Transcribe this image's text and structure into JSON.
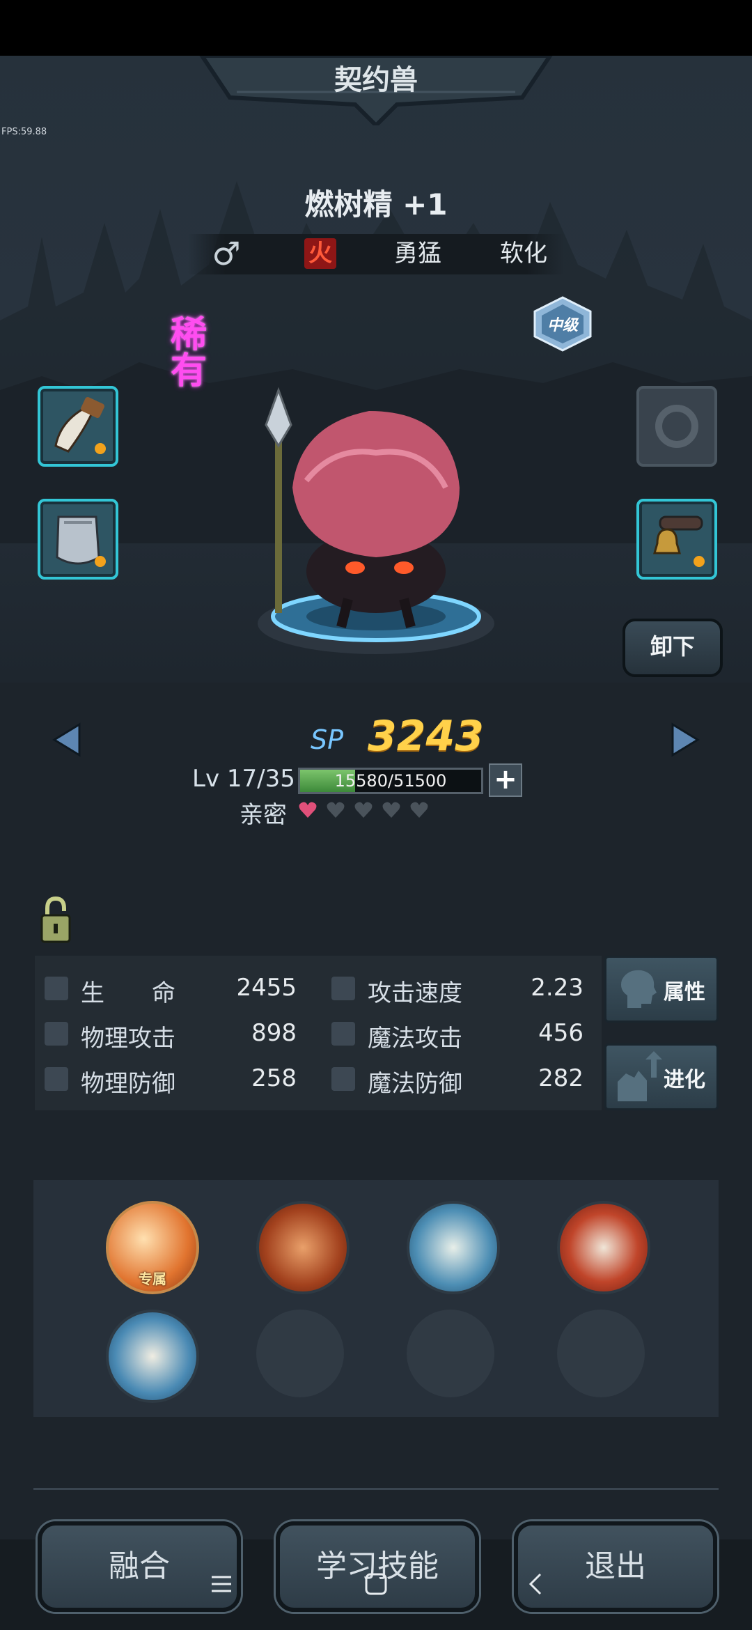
{
  "header": {
    "title": "契约兽",
    "fps": "FPS:59.88"
  },
  "pet": {
    "name": "燃树精 +1",
    "rarity": "稀有",
    "grade_badge": "中级",
    "traits": {
      "gender_symbol": "♂",
      "element": "火",
      "trait1": "勇猛",
      "trait2": "软化"
    }
  },
  "equipment": {
    "slots": [
      {
        "name": "claw-tooth",
        "filled": true
      },
      {
        "name": "armor",
        "filled": true
      },
      {
        "name": "ring",
        "filled": false
      },
      {
        "name": "collar-bell",
        "filled": true
      }
    ]
  },
  "actions": {
    "unequip": "卸下"
  },
  "progress": {
    "sp_label": "SP",
    "sp_value": "3243",
    "level_text": "Lv 17/35",
    "exp_text": "15580/51500",
    "exp_fraction": 0.3025,
    "exp_plus": "+",
    "intimacy_label": "亲密",
    "intimacy_level": 1,
    "intimacy_max": 5
  },
  "stats": {
    "hp_label": "生　　命",
    "hp": "2455",
    "atk_speed_label": "攻击速度",
    "atk_speed": "2.23",
    "patk_label": "物理攻击",
    "patk": "898",
    "matk_label": "魔法攻击",
    "matk": "456",
    "pdef_label": "物理防御",
    "pdef": "258",
    "mdef_label": "魔法防御",
    "mdef": "282"
  },
  "side_buttons": {
    "attributes": "属性",
    "evolve": "进化"
  },
  "skills": {
    "exclusive_tag": "专属",
    "slots": [
      "exclusive-skill",
      "strength-skill",
      "heal-hammer-skill",
      "crossed-axes-skill",
      "hammer-skill",
      "empty",
      "empty",
      "empty"
    ]
  },
  "bottom": {
    "fuse": "融合",
    "learn": "学习技能",
    "exit": "退出"
  },
  "colors": {
    "accent_cyan": "#33c6d6",
    "sp_gold": "#ffd14a",
    "rare_magenta": "#ff4df0",
    "fire_red": "#8e1616"
  }
}
